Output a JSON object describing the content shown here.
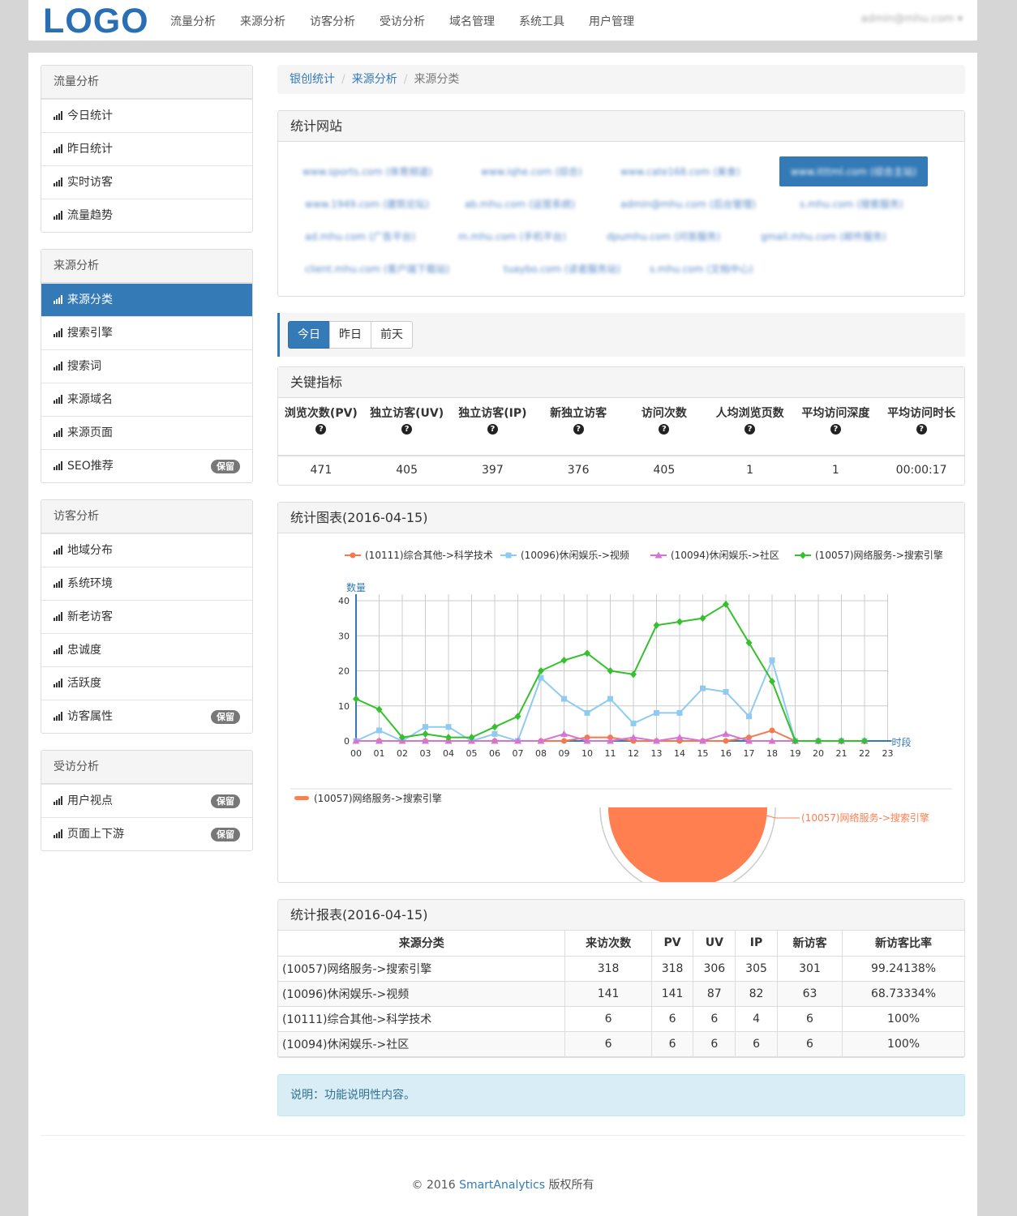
{
  "header": {
    "logo": "LOGO",
    "nav": [
      "流量分析",
      "来源分析",
      "访客分析",
      "受访分析",
      "域名管理",
      "系统工具",
      "用户管理"
    ],
    "user": "admin@mhu.com"
  },
  "sidebar": {
    "groups": [
      {
        "title": "流量分析",
        "items": [
          {
            "label": "今日统计"
          },
          {
            "label": "昨日统计"
          },
          {
            "label": "实时访客"
          },
          {
            "label": "流量趋势"
          }
        ]
      },
      {
        "title": "来源分析",
        "items": [
          {
            "label": "来源分类",
            "active": true
          },
          {
            "label": "搜索引擎"
          },
          {
            "label": "搜索词"
          },
          {
            "label": "来源域名"
          },
          {
            "label": "来源页面"
          },
          {
            "label": "SEO推荐",
            "badge": "保留"
          }
        ]
      },
      {
        "title": "访客分析",
        "items": [
          {
            "label": "地域分布"
          },
          {
            "label": "系统环境"
          },
          {
            "label": "新老访客"
          },
          {
            "label": "忠诚度"
          },
          {
            "label": "活跃度"
          },
          {
            "label": "访客属性",
            "badge": "保留"
          }
        ]
      },
      {
        "title": "受访分析",
        "items": [
          {
            "label": "用户视点",
            "badge": "保留"
          },
          {
            "label": "页面上下游",
            "badge": "保留"
          }
        ]
      }
    ]
  },
  "breadcrumb": {
    "items": [
      "银创统计",
      "来源分析"
    ],
    "current": "来源分类"
  },
  "sites_panel": {
    "title": "统计网站",
    "sites": [
      "www.sports.com (体育频道)",
      "www.iqhe.com (综合)",
      "www.cate168.com (美食)",
      "www.itttml.com (综合主站)",
      "www.1949.com (建筑论坛)",
      "ab.mhu.com (运营系统)",
      "admin@mhu.com (后台管理)",
      "s.mhu.com (搜索服务)",
      "ad.mhu.com (广告平台)",
      "m.mhu.com (手机平台)",
      "dpumhu.com (问答服务)",
      "gmail.mhu.com (邮件服务)",
      "client.mhu.com (客户端下载站)",
      "tuaybo.com (读者服务站)",
      "s.mhu.com (文档中心)"
    ],
    "selected_index": 3
  },
  "day_tabs": [
    "今日",
    "昨日",
    "前天"
  ],
  "kpi": {
    "title": "关键指标",
    "headers": [
      "浏览次数(PV)",
      "独立访客(UV)",
      "独立访客(IP)",
      "新独立访客",
      "访问次数",
      "人均浏览页数",
      "平均访问深度",
      "平均访问时长"
    ],
    "help_icon": "?",
    "values": [
      "471",
      "405",
      "397",
      "376",
      "405",
      "1",
      "1",
      "00:00:17"
    ]
  },
  "chart_panel": {
    "title": "统计图表(2016-04-15)"
  },
  "chart_data": [
    {
      "type": "line",
      "ylabel": "数量",
      "xlabel": "时段",
      "x": [
        "00",
        "01",
        "02",
        "03",
        "04",
        "05",
        "06",
        "07",
        "08",
        "09",
        "10",
        "11",
        "12",
        "13",
        "14",
        "15",
        "16",
        "17",
        "18",
        "19",
        "20",
        "21",
        "22",
        "23"
      ],
      "ylim": [
        0,
        40
      ],
      "yticks": [
        0,
        10,
        20,
        30,
        40
      ],
      "grid": true,
      "legend_position": "top",
      "series": [
        {
          "name": "(10111)综合其他->科学技术",
          "color": "#f4794d",
          "marker": "circle",
          "values": [
            0,
            0,
            0,
            0,
            0,
            0,
            0,
            0,
            0,
            0,
            1,
            1,
            0,
            0,
            0,
            0,
            0,
            1,
            3,
            0,
            0,
            0,
            0,
            null
          ]
        },
        {
          "name": "(10096)休闲娱乐->视频",
          "color": "#8fcbf0",
          "marker": "square",
          "values": [
            0,
            3,
            0,
            4,
            4,
            0,
            2,
            0,
            18,
            12,
            8,
            12,
            5,
            8,
            8,
            15,
            14,
            7,
            23,
            0,
            0,
            0,
            0,
            null
          ]
        },
        {
          "name": "(10094)休闲娱乐->社区",
          "color": "#d674d6",
          "marker": "triangle",
          "values": [
            0,
            0,
            0,
            0,
            0,
            0,
            0,
            0,
            0,
            2,
            0,
            0,
            1,
            0,
            1,
            0,
            2,
            0,
            0,
            0,
            0,
            0,
            0,
            null
          ]
        },
        {
          "name": "(10057)网络服务->搜索引擎",
          "color": "#34c12c",
          "marker": "diamond",
          "values": [
            12,
            9,
            1,
            2,
            1,
            1,
            4,
            7,
            20,
            23,
            25,
            20,
            19,
            33,
            34,
            35,
            39,
            28,
            17,
            0,
            0,
            0,
            0,
            null
          ]
        }
      ]
    },
    {
      "type": "pie",
      "legend_position": "top-left",
      "slices": [
        {
          "name": "(10057)网络服务->搜索引擎",
          "value": 318,
          "color": "#ff7f50"
        }
      ]
    }
  ],
  "report": {
    "title": "统计报表(2016-04-15)",
    "columns": [
      "来源分类",
      "来访次数",
      "PV",
      "UV",
      "IP",
      "新访客",
      "新访客比率"
    ],
    "rows": [
      [
        "(10057)网络服务->搜索引擎",
        "318",
        "318",
        "306",
        "305",
        "301",
        "99.24138%"
      ],
      [
        "(10096)休闲娱乐->视频",
        "141",
        "141",
        "87",
        "82",
        "63",
        "68.73334%"
      ],
      [
        "(10111)综合其他->科学技术",
        "6",
        "6",
        "6",
        "4",
        "6",
        "100%"
      ],
      [
        "(10094)休闲娱乐->社区",
        "6",
        "6",
        "6",
        "6",
        "6",
        "100%"
      ]
    ]
  },
  "note": "说明：功能说明性内容。",
  "footer": {
    "prefix": "© 2016 ",
    "brand": "SmartAnalytics",
    "suffix": " 版权所有"
  }
}
